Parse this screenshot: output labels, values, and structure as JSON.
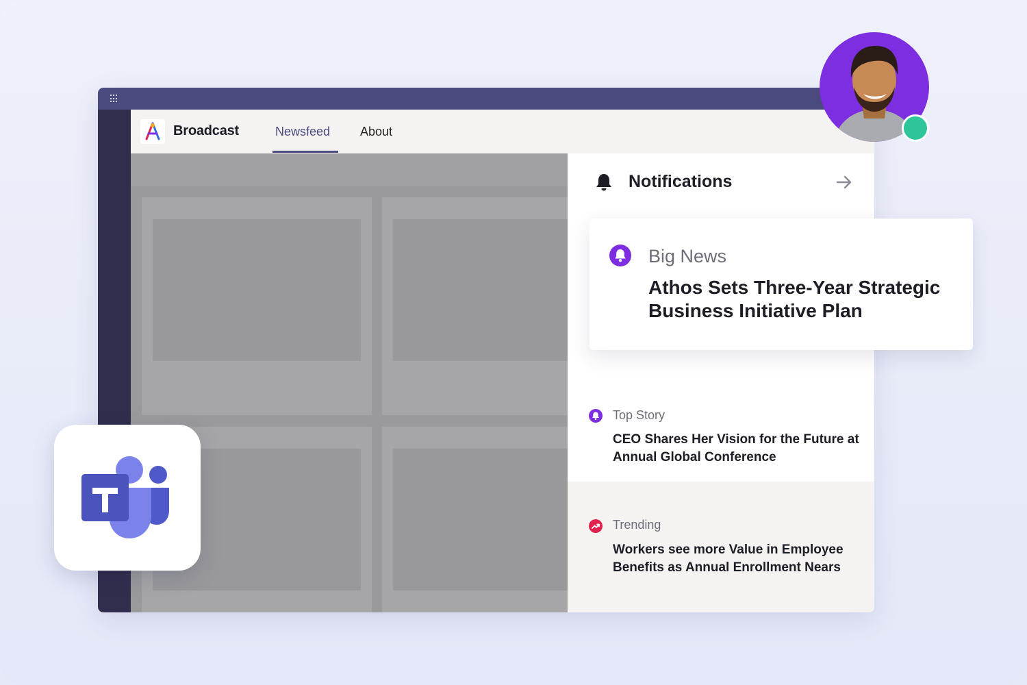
{
  "app": {
    "brand": "Broadcast",
    "tabs": [
      {
        "label": "Newsfeed",
        "active": true
      },
      {
        "label": "About",
        "active": false
      }
    ]
  },
  "notifications": {
    "title": "Notifications",
    "featured": {
      "category": "Big News",
      "headline": "Athos Sets Three-Year Strategic Business Initiative Plan",
      "icon": "bell-icon"
    },
    "items": [
      {
        "category": "Top Story",
        "headline": "CEO Shares Her Vision for the Future at Annual Global Conference",
        "icon": "bell-icon"
      },
      {
        "category": "Trending",
        "headline": "Workers see more Value in Employee Benefits as Annual Enrollment Nears",
        "icon": "trending-icon"
      }
    ]
  },
  "colors": {
    "titlebar": "#4b4a7f",
    "rail": "#2f2e4c",
    "accent_purple": "#7c2ee0",
    "trending_red": "#e0234e",
    "status_online": "#2ec59a",
    "teams_primary": "#5059c9"
  },
  "user": {
    "presence": "online"
  }
}
